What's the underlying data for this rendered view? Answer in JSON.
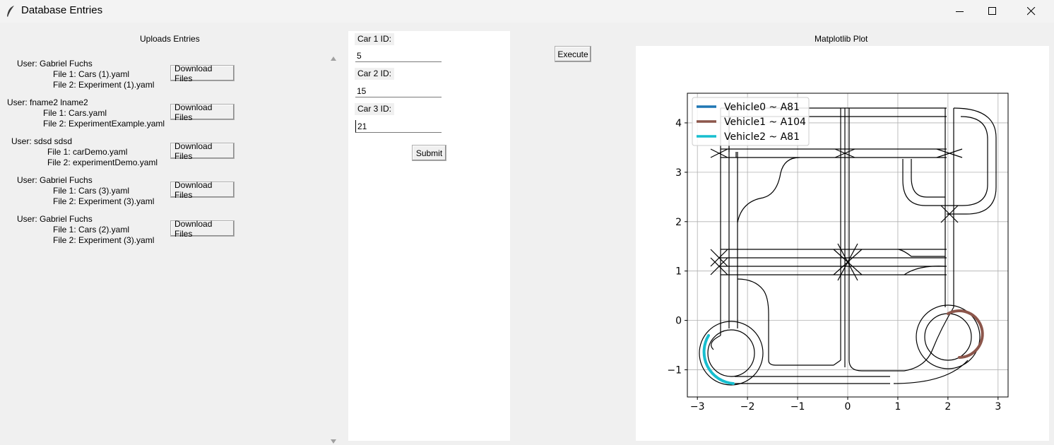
{
  "window": {
    "title": "Database Entries",
    "icon": "feather-icon",
    "controls": [
      "minimize-icon",
      "maximize-icon",
      "close-icon"
    ]
  },
  "uploads": {
    "title": "Uploads Entries",
    "download_label": "Download Files",
    "entries": [
      {
        "user": "User: Gabriel Fuchs",
        "file1": "File 1: Cars (1).yaml",
        "file2": "File 2: Experiment (1).yaml"
      },
      {
        "user": "User: fname2 lname2",
        "file1": "File 1: Cars.yaml",
        "file2": "File 2: ExperimentExample.yaml"
      },
      {
        "user": "User: sdsd sdsd",
        "file1": "File 1: carDemo.yaml",
        "file2": "File 2: experimentDemo.yaml"
      },
      {
        "user": "User: Gabriel Fuchs",
        "file1": "File 1: Cars (3).yaml",
        "file2": "File 2: Experiment (3).yaml"
      },
      {
        "user": "User: Gabriel Fuchs",
        "file1": "File 1: Cars (2).yaml",
        "file2": "File 2: Experiment (3).yaml"
      }
    ]
  },
  "form": {
    "car1_label": "Car 1 ID:",
    "car1_value": "5",
    "car2_label": "Car 2 ID:",
    "car2_value": "15",
    "car3_label": "Car 3 ID:",
    "car3_value": "21",
    "submit_label": "Submit"
  },
  "execute_label": "Execute",
  "plot": {
    "title": "Matplotlib Plot",
    "chart_data": {
      "type": "line",
      "xlim": [
        -3.2,
        3.2
      ],
      "ylim": [
        -1.55,
        4.6
      ],
      "xticks": [
        "−3",
        "−2",
        "−1",
        "0",
        "1",
        "2",
        "3"
      ],
      "yticks": [
        "−1",
        "0",
        "1",
        "2",
        "3",
        "4"
      ],
      "grid": true,
      "legend_position": "upper left",
      "series": [
        {
          "name": "Vehicle0 ~ A81",
          "color": "#1f77b4"
        },
        {
          "name": "Vehicle1 ~ A104",
          "color": "#8c564b"
        },
        {
          "name": "Vehicle2 ~ A81",
          "color": "#17becf"
        }
      ]
    }
  }
}
